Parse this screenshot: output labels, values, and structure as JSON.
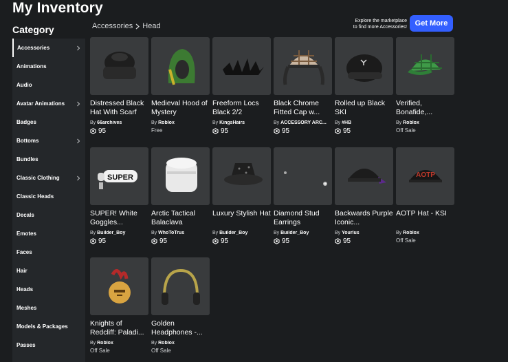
{
  "header": {
    "title": "My Inventory"
  },
  "sidebar": {
    "heading": "Category",
    "items": [
      {
        "label": "Accessories",
        "chevron": true,
        "active": true
      },
      {
        "label": "Animations",
        "chevron": false
      },
      {
        "label": "Audio",
        "chevron": false
      },
      {
        "label": "Avatar Animations",
        "chevron": true
      },
      {
        "label": "Badges",
        "chevron": false
      },
      {
        "label": "Bottoms",
        "chevron": true
      },
      {
        "label": "Bundles",
        "chevron": false
      },
      {
        "label": "Classic Clothing",
        "chevron": true
      },
      {
        "label": "Classic Heads",
        "chevron": false
      },
      {
        "label": "Decals",
        "chevron": false
      },
      {
        "label": "Emotes",
        "chevron": false
      },
      {
        "label": "Faces",
        "chevron": false
      },
      {
        "label": "Hair",
        "chevron": false
      },
      {
        "label": "Heads",
        "chevron": false
      },
      {
        "label": "Meshes",
        "chevron": false
      },
      {
        "label": "Models & Packages",
        "chevron": false
      },
      {
        "label": "Passes",
        "chevron": false
      }
    ]
  },
  "breadcrumb": {
    "parent": "Accessories",
    "current": "Head"
  },
  "promo": {
    "line1": "Explore the marketplace",
    "line2": "to find more Accessories!",
    "button": "Get More"
  },
  "colors": {
    "accent": "#335fff",
    "background": "#1b1d1f",
    "sidebar": "#24272a",
    "thumb": "#393b3d"
  },
  "items": [
    {
      "name": "Distressed Black Hat With Scarf",
      "by": "By",
      "creator": "66archives",
      "price": "95",
      "status": "",
      "icon": "black-hat-scarf"
    },
    {
      "name": "Medieval Hood of Mystery",
      "by": "By",
      "creator": "Roblox",
      "price": "",
      "status": "Free",
      "icon": "green-hood"
    },
    {
      "name": "Freeform Locs Black 2/2",
      "by": "By",
      "creator": "KingsHairs",
      "price": "95",
      "status": "",
      "icon": "black-locs"
    },
    {
      "name": "Black Chrome Fitted Cap w...",
      "by": "By",
      "creator": "ACCESSORY ARC...",
      "price": "95",
      "status": "",
      "icon": "plaid-cap"
    },
    {
      "name": "Rolled up Black SKI",
      "by": "By",
      "creator": "#HB",
      "price": "95",
      "status": "",
      "icon": "black-ski-mask"
    },
    {
      "name": "Verified, Bonafide,...",
      "by": "By",
      "creator": "Roblox",
      "price": "",
      "status": "Off Sale",
      "icon": "green-plaid-cap"
    },
    {
      "name": "SUPER! White Goggles...",
      "by": "By",
      "creator": "Builder_Boy",
      "price": "95",
      "status": "",
      "icon": "super-goggles"
    },
    {
      "name": "Arctic Tactical Balaclava",
      "by": "By",
      "creator": "WhoToTrus",
      "price": "95",
      "status": "",
      "icon": "white-balaclava"
    },
    {
      "name": "Luxury Stylish Hat",
      "by": "By",
      "creator": "Builder_Boy",
      "price": "95",
      "status": "",
      "icon": "bucket-hat"
    },
    {
      "name": "Diamond Stud Earrings",
      "by": "By",
      "creator": "Builder_Boy",
      "price": "95",
      "status": "",
      "icon": "stud-earrings"
    },
    {
      "name": "Backwards Purple Iconic...",
      "by": "By",
      "creator": "Yourlus",
      "price": "95",
      "status": "",
      "icon": "backwards-cap"
    },
    {
      "name": "AOTP Hat - KSI",
      "by": "By",
      "creator": "Roblox",
      "price": "",
      "status": "Off Sale",
      "icon": "aotp-cap",
      "cap_text": "AOTP"
    },
    {
      "name": "Knights of Redcliff: Paladi...",
      "by": "By",
      "creator": "Roblox",
      "price": "",
      "status": "Off Sale",
      "icon": "paladin-helmet"
    },
    {
      "name": "Golden Headphones -...",
      "by": "By",
      "creator": "Roblox",
      "price": "",
      "status": "Off Sale",
      "icon": "golden-headphones"
    }
  ],
  "goggle_text": "SUPER"
}
